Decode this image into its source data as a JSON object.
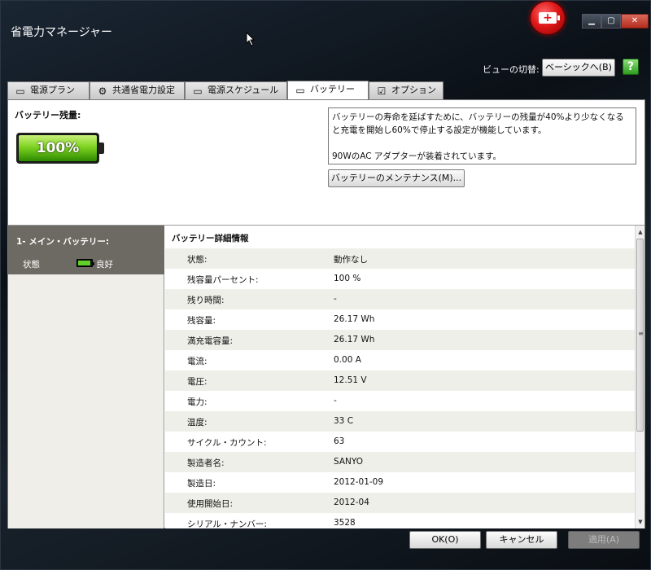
{
  "window": {
    "title": "省電力マネージャー"
  },
  "header": {
    "view_switch_label": "ビューの切替:",
    "view_switch_button": "ベーシックへ(B)",
    "help_icon": "?"
  },
  "tabs": [
    {
      "label": "電源プラン",
      "icon": "power-plan-icon",
      "active": false
    },
    {
      "label": "共通省電力設定",
      "icon": "gear-icon",
      "active": false
    },
    {
      "label": "電源スケジュール",
      "icon": "schedule-icon",
      "active": false
    },
    {
      "label": "バッテリー",
      "icon": "battery-icon",
      "active": true
    },
    {
      "label": "オプション",
      "icon": "checkbox-icon",
      "active": false
    }
  ],
  "battery": {
    "remaining_label": "バッテリー残量:",
    "percent_text": "100%",
    "level": 1.0,
    "info_line1": "バッテリーの寿命を延ばすために、バッテリーの残量が40%より少なくなる",
    "info_line2": "と充電を開始し60%で停止する設定が機能しています。",
    "info_line3": "90WのAC アダプターが装着されています。",
    "maintenance_button": "バッテリーのメンテナンス(M)..."
  },
  "sidebar": {
    "battery_title": "1- メイン・バッテリー:",
    "status_label": "状態",
    "status_value": "良好"
  },
  "details": {
    "title": "バッテリー詳細情報",
    "rows": [
      {
        "key": "状態:",
        "value": "動作なし"
      },
      {
        "key": "残容量パーセント:",
        "value": "100 %"
      },
      {
        "key": "残り時間:",
        "value": "-"
      },
      {
        "key": "残容量:",
        "value": "26.17 Wh"
      },
      {
        "key": "満充電容量:",
        "value": "26.17 Wh"
      },
      {
        "key": "電流:",
        "value": "0.00 A"
      },
      {
        "key": "電圧:",
        "value": "12.51 V"
      },
      {
        "key": "電力:",
        "value": "-"
      },
      {
        "key": "温度:",
        "value": "33 C"
      },
      {
        "key": "サイクル・カウント:",
        "value": "63"
      },
      {
        "key": "製造者名:",
        "value": "SANYO"
      },
      {
        "key": "製造日:",
        "value": "2012-01-09"
      },
      {
        "key": "使用開始日:",
        "value": "2012-04"
      },
      {
        "key": "シリアル・ナンバー:",
        "value": "3528"
      }
    ]
  },
  "footer": {
    "ok": "OK(O)",
    "cancel": "キャンセル",
    "apply": "適用(A)"
  },
  "colors": {
    "accent_green": "#7ed321",
    "sidebar_header": "#6c6a62",
    "row_alt": "#efefe9"
  }
}
